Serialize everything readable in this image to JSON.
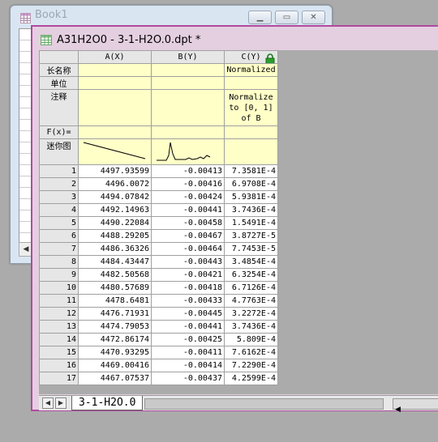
{
  "back_window": {
    "title": "Book1"
  },
  "front_window": {
    "title": "A31H2O0 - 3-1-H2O.0.dpt *"
  },
  "columns": [
    {
      "header": "A(X)",
      "long_name": "",
      "units": "",
      "comments": ""
    },
    {
      "header": "B(Y)",
      "long_name": "",
      "units": "",
      "comments": ""
    },
    {
      "header": "C(Y)",
      "long_name": "Normalized",
      "units": "",
      "comments": "Normalize to [0, 1] of B"
    }
  ],
  "row_labels": {
    "long_name": "长名称",
    "units": "单位",
    "comments": "注释",
    "fx": "F(x)=",
    "sparkline": "迷你图"
  },
  "rows": [
    [
      "1",
      "4497.93599",
      "-0.00413",
      "7.3581E-4"
    ],
    [
      "2",
      "4496.0072",
      "-0.00416",
      "6.9708E-4"
    ],
    [
      "3",
      "4494.07842",
      "-0.00424",
      "5.9381E-4"
    ],
    [
      "4",
      "4492.14963",
      "-0.00441",
      "3.7436E-4"
    ],
    [
      "5",
      "4490.22084",
      "-0.00458",
      "1.5491E-4"
    ],
    [
      "6",
      "4488.29205",
      "-0.00467",
      "3.8727E-5"
    ],
    [
      "7",
      "4486.36326",
      "-0.00464",
      "7.7453E-5"
    ],
    [
      "8",
      "4484.43447",
      "-0.00443",
      "3.4854E-4"
    ],
    [
      "9",
      "4482.50568",
      "-0.00421",
      "6.3254E-4"
    ],
    [
      "10",
      "4480.57689",
      "-0.00418",
      "6.7126E-4"
    ],
    [
      "11",
      "4478.6481",
      "-0.00433",
      "4.7763E-4"
    ],
    [
      "12",
      "4476.71931",
      "-0.00445",
      "3.2272E-4"
    ],
    [
      "13",
      "4474.79053",
      "-0.00441",
      "3.7436E-4"
    ],
    [
      "14",
      "4472.86174",
      "-0.00425",
      "5.809E-4"
    ],
    [
      "15",
      "4470.93295",
      "-0.00411",
      "7.6162E-4"
    ],
    [
      "16",
      "4469.00416",
      "-0.00414",
      "7.2290E-4"
    ],
    [
      "17",
      "4467.07537",
      "-0.00437",
      "4.2599E-4"
    ]
  ],
  "sheet_tab": "3-1-H2O.0",
  "icons": {
    "window": "worksheet-icon",
    "lock": "lock-icon"
  },
  "colors": {
    "accent": "#b04a9e",
    "meta_bg": "#ffffc8"
  }
}
